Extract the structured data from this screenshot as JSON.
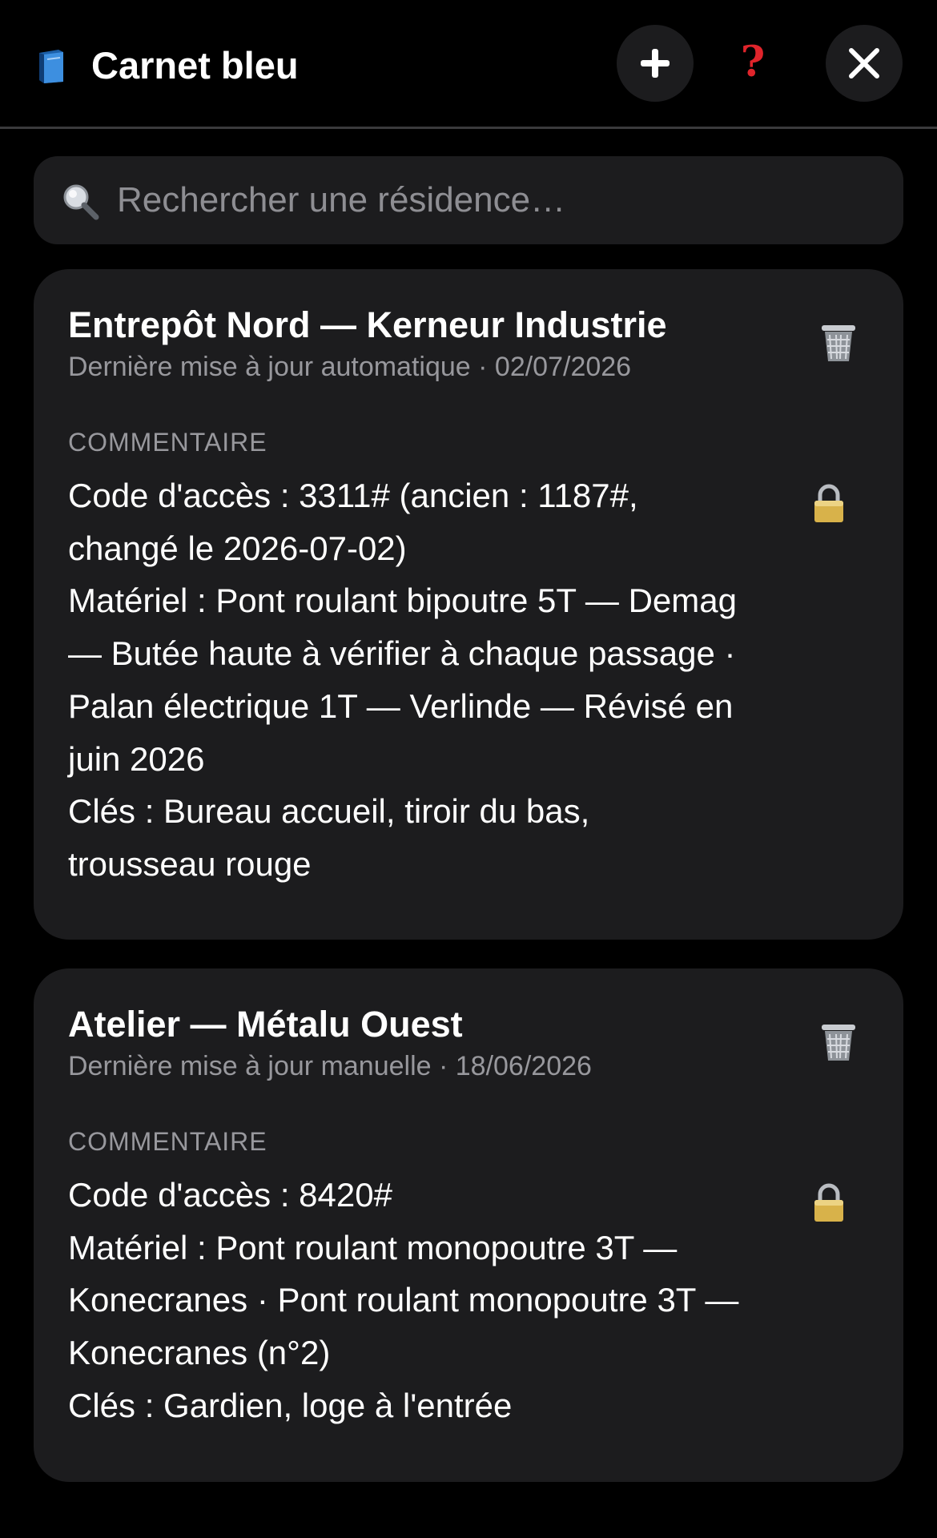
{
  "header": {
    "app_title": "Carnet bleu",
    "app_icon": "blue-book-icon",
    "add_icon": "plus-icon",
    "help_icon": "question-mark-icon",
    "close_icon": "close-icon"
  },
  "search": {
    "icon": "magnifying-glass-icon",
    "placeholder": "Rechercher une résidence…",
    "value": ""
  },
  "colors": {
    "background": "#000000",
    "card": "#1c1c1e",
    "secondary_text": "#98989d",
    "help_red": "#e0242b",
    "lock_gold": "#d8b24a"
  },
  "cards": [
    {
      "title": "Entrepôt Nord — Kerneur Industrie",
      "subtitle": "Dernière mise à jour automatique · 02/07/2026",
      "section_label": "COMMENTAIRE",
      "comment_lines": [
        "Code d'accès : 3311# (ancien : 1187#,",
        "changé le 2026-07-02)",
        "Matériel : Pont roulant bipoutre 5T — Demag",
        "— Butée haute à vérifier à chaque passage ·",
        "Palan électrique 1T — Verlinde — Révisé en",
        "juin 2026",
        "Clés : Bureau accueil, tiroir du bas,",
        "trousseau rouge"
      ],
      "delete_icon": "trash-icon",
      "lock_icon": "lock-icon"
    },
    {
      "title": "Atelier — Métalu Ouest",
      "subtitle": "Dernière mise à jour manuelle · 18/06/2026",
      "section_label": "COMMENTAIRE",
      "comment_lines": [
        "Code d'accès : 8420#",
        "Matériel : Pont roulant monopoutre 3T —",
        "Konecranes · Pont roulant monopoutre 3T —",
        "Konecranes (n°2)",
        "Clés : Gardien, loge à l'entrée"
      ],
      "delete_icon": "trash-icon",
      "lock_icon": "lock-icon"
    }
  ]
}
